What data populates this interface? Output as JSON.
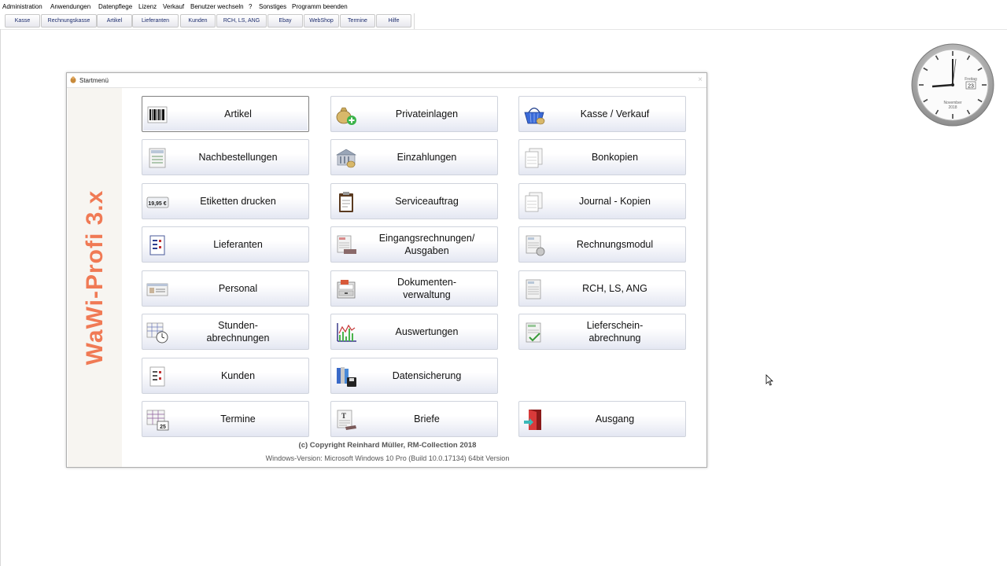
{
  "menu": [
    "Administration",
    "Anwendungen",
    "Datenpflege",
    "Lizenz",
    "Verkauf",
    "Benutzer wechseln",
    "?",
    "Sonstiges",
    "Programm beenden"
  ],
  "toolbar": [
    "Kasse",
    "Rechnungskasse",
    "Artikel",
    "Lieferanten",
    "Kunden",
    "RCH, LS, ANG",
    "Ebay",
    "WebShop",
    "Termine",
    "Hilfe"
  ],
  "clock": {
    "weekday": "Freitag",
    "day": "23",
    "month": "November",
    "year": "2018"
  },
  "window": {
    "title": "Startmenü",
    "close": "×",
    "brand": "WaWi-Profi 3.x",
    "copyright": "(c) Copyright Reinhard Müller, RM-Collection 2018",
    "winver": "Windows-Version: Microsoft Windows 10 Pro (Build 10.0.17134) 64bit Version"
  },
  "buttons": [
    {
      "label": "Artikel",
      "icon": "barcode-icon"
    },
    {
      "label": "Privateinlagen",
      "icon": "money-bag-plus-icon"
    },
    {
      "label": "Kasse / Verkauf",
      "icon": "shopping-basket-icon"
    },
    {
      "label": "Nachbestellungen",
      "icon": "order-list-icon"
    },
    {
      "label": "Einzahlungen",
      "icon": "bank-icon"
    },
    {
      "label": "Bonkopien",
      "icon": "receipt-copy-icon"
    },
    {
      "label": "Etiketten drucken",
      "icon": "price-label-icon"
    },
    {
      "label": "Serviceauftrag",
      "icon": "clipboard-icon"
    },
    {
      "label": "Journal - Kopien",
      "icon": "journal-copy-icon"
    },
    {
      "label": "Lieferanten",
      "icon": "supplier-list-icon"
    },
    {
      "label": "Eingangsrechnungen/\nAusgaben",
      "icon": "incoming-invoice-icon"
    },
    {
      "label": "Rechnungsmodul",
      "icon": "invoice-module-icon"
    },
    {
      "label": "Personal",
      "icon": "staff-card-icon"
    },
    {
      "label": "Dokumenten-\nverwaltung",
      "icon": "document-drawer-icon"
    },
    {
      "label": "RCH, LS, ANG",
      "icon": "invoice-doc-icon"
    },
    {
      "label": "Stunden-\nabrechnungen",
      "icon": "timesheet-clock-icon"
    },
    {
      "label": "Auswertungen",
      "icon": "line-chart-icon"
    },
    {
      "label": "Lieferschein-\nabrechnung",
      "icon": "delivery-note-icon"
    },
    {
      "label": "Kunden",
      "icon": "customer-list-icon"
    },
    {
      "label": "Datensicherung",
      "icon": "backup-disk-icon"
    },
    {
      "label": "Termine",
      "icon": "calendar-icon"
    },
    {
      "label": "Briefe",
      "icon": "letter-icon"
    },
    {
      "label": "Ausgang",
      "icon": "exit-door-icon"
    }
  ]
}
